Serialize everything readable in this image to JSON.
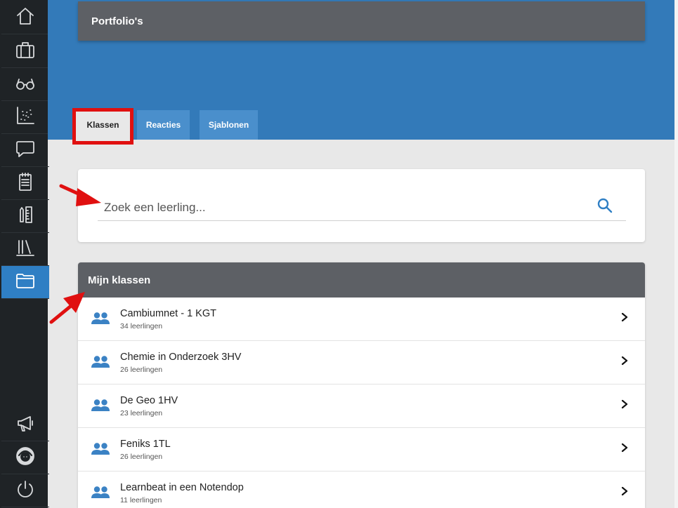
{
  "header": {
    "title": "Portfolio's"
  },
  "tabs": [
    {
      "label": "Klassen",
      "active": true
    },
    {
      "label": "Reacties",
      "active": false
    },
    {
      "label": "Sjablonen",
      "active": false
    }
  ],
  "search": {
    "placeholder": "Zoek een leerling..."
  },
  "classes": {
    "title": "Mijn klassen",
    "items": [
      {
        "name": "Cambiumnet - 1 KGT",
        "count": "34 leerlingen"
      },
      {
        "name": "Chemie in Onderzoek 3HV",
        "count": "26 leerlingen"
      },
      {
        "name": "De Geo 1HV",
        "count": "23 leerlingen"
      },
      {
        "name": "Feniks 1TL",
        "count": "26 leerlingen"
      },
      {
        "name": "Learnbeat in een Notendop",
        "count": "11 leerlingen"
      }
    ]
  },
  "sidebar": {
    "top_icons": [
      "home-icon",
      "briefcase-icon",
      "glasses-icon",
      "scatter-chart-icon",
      "chat-icon",
      "notepad-icon",
      "ruler-pencil-icon",
      "library-icon",
      "folder-icon"
    ],
    "bottom_icons": [
      "megaphone-icon",
      "support-avatar-icon",
      "power-icon"
    ],
    "active": "folder-icon"
  },
  "colors": {
    "accent": "#337ab9",
    "sidebar": "#1f2326",
    "highlight": "#e01010",
    "panel_header": "#5d6065"
  }
}
